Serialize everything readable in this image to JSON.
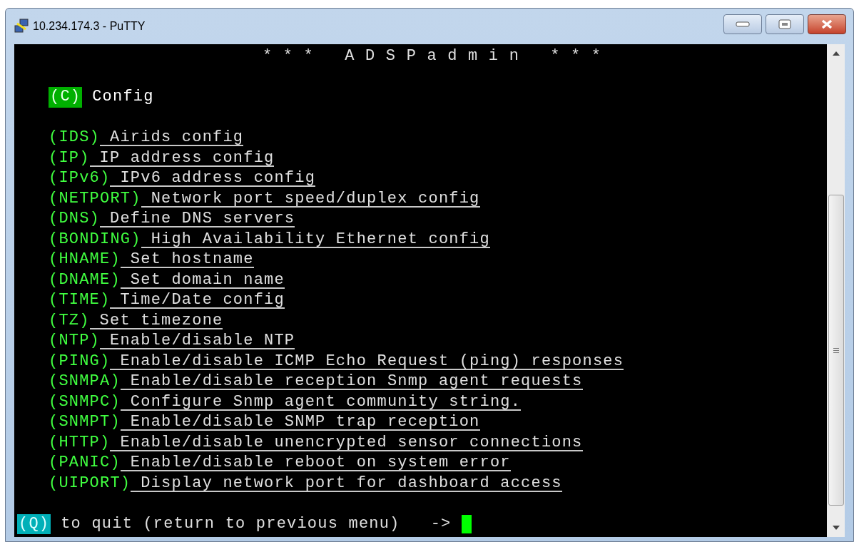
{
  "window": {
    "title": "10.234.174.3 - PuTTY"
  },
  "terminal": {
    "banner": "* * *   A D S P a d m i n   * * *",
    "menu_title": {
      "key": "(C)",
      "label": "Config"
    },
    "items": [
      {
        "key": "(IDS)",
        "label": "Airids config"
      },
      {
        "key": "(IP)",
        "label": "IP address config"
      },
      {
        "key": "(IPv6)",
        "label": "IPv6 address config"
      },
      {
        "key": "(NETPORT)",
        "label": "Network port speed/duplex config"
      },
      {
        "key": "(DNS)",
        "label": "Define DNS servers"
      },
      {
        "key": "(BONDING)",
        "label": "High Availability Ethernet config"
      },
      {
        "key": "(HNAME)",
        "label": "Set hostname"
      },
      {
        "key": "(DNAME)",
        "label": "Set domain name"
      },
      {
        "key": "(TIME)",
        "label": "Time/Date config"
      },
      {
        "key": "(TZ)",
        "label": "Set timezone"
      },
      {
        "key": "(NTP)",
        "label": "Enable/disable NTP"
      },
      {
        "key": "(PING)",
        "label": "Enable/disable ICMP Echo Request (ping) responses"
      },
      {
        "key": "(SNMPA)",
        "label": "Enable/disable reception Snmp agent requests"
      },
      {
        "key": "(SNMPC)",
        "label": "Configure Snmp agent community string."
      },
      {
        "key": "(SNMPT)",
        "label": "Enable/disable SNMP trap reception"
      },
      {
        "key": "(HTTP)",
        "label": "Enable/disable unencrypted sensor connections"
      },
      {
        "key": "(PANIC)",
        "label": "Enable/disable reboot on system error"
      },
      {
        "key": "(UIPORT)",
        "label": "Display network port for dashboard access"
      }
    ],
    "prompt": {
      "key": "(Q)",
      "text": "to quit (return to previous menu)   ->"
    }
  }
}
